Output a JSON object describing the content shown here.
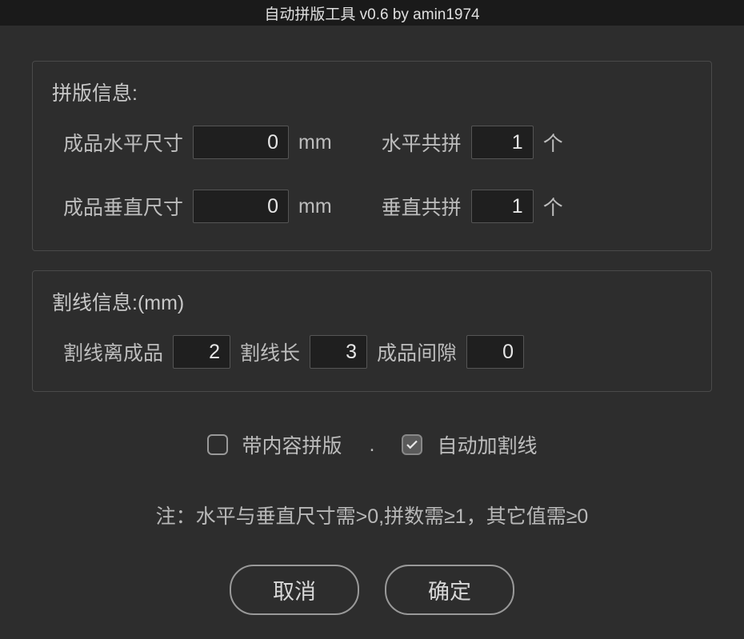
{
  "title": "自动拼版工具 v0.6   by amin1974",
  "section1": {
    "title": "拼版信息:",
    "row1": {
      "label_size": "成品水平尺寸",
      "value_size": "0",
      "unit": "mm",
      "label_count": "水平共拼",
      "value_count": "1",
      "unit_count": "个"
    },
    "row2": {
      "label_size": "成品垂直尺寸",
      "value_size": "0",
      "unit": "mm",
      "label_count": "垂直共拼",
      "value_count": "1",
      "unit_count": "个"
    }
  },
  "section2": {
    "title": "割线信息:(mm)",
    "label_dist": "割线离成品",
    "value_dist": "2",
    "label_len": "割线长",
    "value_len": "3",
    "label_gap": "成品间隙",
    "value_gap": "0"
  },
  "checkboxes": {
    "with_content_label": "带内容拼版",
    "dot": ".",
    "auto_cut_label": "自动加割线"
  },
  "note": "注：水平与垂直尺寸需>0,拼数需≥1，其它值需≥0",
  "buttons": {
    "cancel": "取消",
    "ok": "确定"
  }
}
